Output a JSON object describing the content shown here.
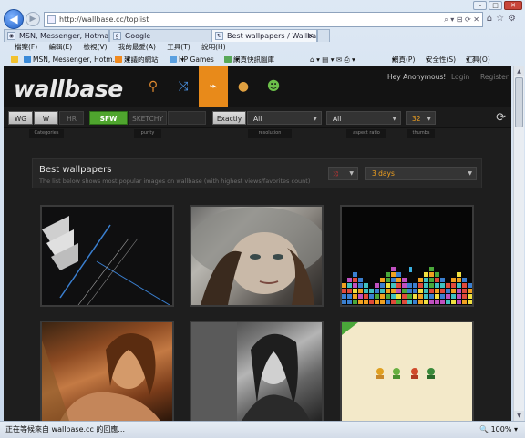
{
  "browser": {
    "address": "http://wallbase.cc/toplist",
    "tabs": [
      {
        "title": "MSN, Messenger, Hotmail -"
      },
      {
        "title": "Google"
      },
      {
        "title": "Best wallpapers / Wallbas..."
      }
    ],
    "menu": [
      "檔案(F)",
      "編輯(E)",
      "檢視(V)",
      "我的最愛(A)",
      "工具(T)",
      "說明(H)"
    ],
    "favorites": [
      "MSN, Messenger, Hotm...",
      "建議的網站",
      "HP Games",
      "網頁快訊圖庫"
    ],
    "commands": [
      "網頁(P)",
      "安全性(S)",
      "工具(O)"
    ],
    "status_text": "正在等候來自 wallbase.cc 的回應...",
    "zoom": "100%"
  },
  "site": {
    "logo": "wallbase",
    "user": "Hey Anonymous!",
    "login": "Login",
    "register": "Register",
    "filters": {
      "categories": [
        "WG",
        "W",
        "HR"
      ],
      "purity": [
        "SFW",
        "SKETCHY",
        ""
      ],
      "exactly": "Exactly",
      "resolution": "All",
      "aspect": "All",
      "thumbs": "32"
    },
    "labels": {
      "categories": "Categories",
      "purity": "purity",
      "resolution": "resolution",
      "aspect": "aspect ratio",
      "thumbs": "thumbs"
    },
    "section": {
      "title": "Best wallpapers",
      "subtitle": "The list below shows most popular images on wallbase (with highest views/favorites count)",
      "period": "3 days"
    }
  },
  "colors": {
    "accent": "#e88a1a",
    "sfw": "#4fa52e",
    "background": "#1e1e1e"
  }
}
